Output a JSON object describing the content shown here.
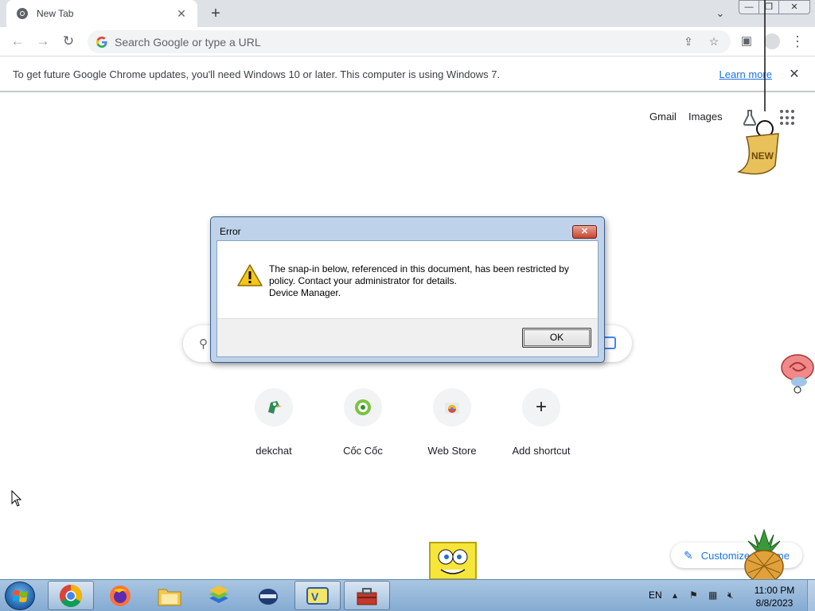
{
  "browser": {
    "tab_title": "New Tab",
    "tab_close": "✕",
    "new_tab": "+",
    "tab_search": "⌄",
    "window_controls": {
      "minimize": "—",
      "maximize": "❐",
      "close": "✕"
    },
    "omnibox_placeholder": "Search Google or type a URL",
    "nav": {
      "back": "←",
      "forward": "→",
      "reload": "↻"
    },
    "menu": "⋮"
  },
  "infobar": {
    "message": "To get future Google Chrome updates, you'll need Windows 10 or later. This computer is using Windows 7.",
    "link": "Learn more",
    "close": "✕"
  },
  "ntp": {
    "links": [
      "Gmail",
      "Images"
    ],
    "shortcuts": [
      {
        "label": "dekchat",
        "icon": "dekchat-icon"
      },
      {
        "label": "Cốc Cốc",
        "icon": "coccoc-icon"
      },
      {
        "label": "Web Store",
        "icon": "webstore-icon"
      },
      {
        "label": "Add shortcut",
        "icon": "plus-icon"
      }
    ],
    "add_symbol": "+",
    "customize_label": "Customize Chrome",
    "customize_pen": "✎"
  },
  "dialog": {
    "title": "Error",
    "close": "✕",
    "message_lines": [
      "The snap-in below, referenced in this document, has been restricted by",
      "policy. Contact your administrator for details.",
      "Device Manager."
    ],
    "ok_label": "OK"
  },
  "taskbar": {
    "language": "EN",
    "time": "11:00 PM",
    "date": "8/8/2023",
    "apps": [
      "chrome",
      "firefox",
      "file-explorer",
      "bluestacks",
      "vpn",
      "unikey",
      "toolbox"
    ]
  },
  "colors": {
    "accent": "#1a73e8",
    "dialog_frame": "#bed3ea",
    "taskbar": "#85abd2"
  }
}
